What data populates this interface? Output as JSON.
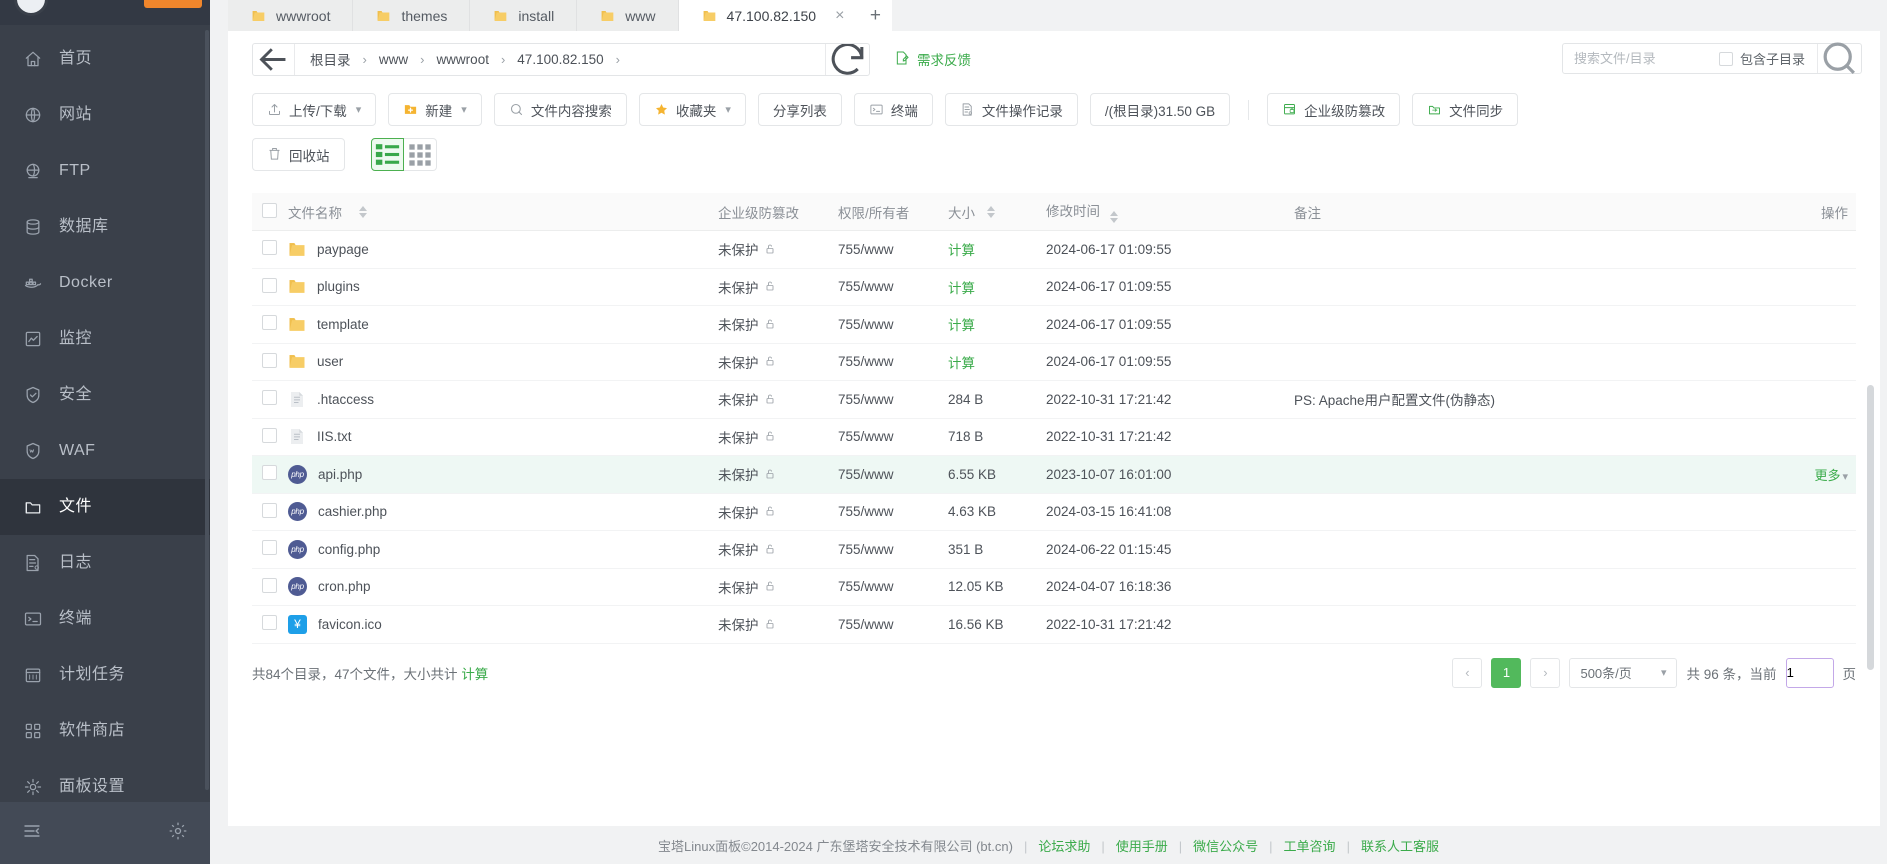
{
  "sidebar": {
    "items": [
      {
        "label": "首页",
        "icon": "home-icon",
        "active": false
      },
      {
        "label": "网站",
        "icon": "globe-icon",
        "active": false
      },
      {
        "label": "FTP",
        "icon": "ftp-icon",
        "active": false
      },
      {
        "label": "数据库",
        "icon": "database-icon",
        "active": false
      },
      {
        "label": "Docker",
        "icon": "docker-icon",
        "active": false
      },
      {
        "label": "监控",
        "icon": "monitor-icon",
        "active": false
      },
      {
        "label": "安全",
        "icon": "shield-icon",
        "active": false
      },
      {
        "label": "WAF",
        "icon": "waf-shield-icon",
        "active": false
      },
      {
        "label": "文件",
        "icon": "folder-icon",
        "active": true
      },
      {
        "label": "日志",
        "icon": "log-icon",
        "active": false
      },
      {
        "label": "终端",
        "icon": "terminal-icon",
        "active": false
      },
      {
        "label": "计划任务",
        "icon": "calendar-icon",
        "active": false
      },
      {
        "label": "软件商店",
        "icon": "appstore-icon",
        "active": false
      },
      {
        "label": "面板设置",
        "icon": "gear-icon",
        "active": false
      }
    ]
  },
  "tabs": [
    {
      "label": "wwwroot",
      "active": false,
      "closable": false
    },
    {
      "label": "themes",
      "active": false,
      "closable": false
    },
    {
      "label": "install",
      "active": false,
      "closable": false
    },
    {
      "label": "www",
      "active": false,
      "closable": false
    },
    {
      "label": "47.100.82.150",
      "active": true,
      "closable": true
    }
  ],
  "tab_add_label": "+",
  "path": {
    "crumbs": [
      "根目录",
      "www",
      "wwwroot",
      "47.100.82.150"
    ],
    "separator": "›",
    "trailing_separator": "›",
    "feedback_label": "需求反馈"
  },
  "search": {
    "placeholder": "搜索文件/目录",
    "value": "",
    "subdir_label": "包含子目录",
    "subdir_checked": false
  },
  "toolbar": {
    "row1": [
      {
        "label": "上传/下载",
        "icon": "upload-icon",
        "caret": true,
        "accent": ""
      },
      {
        "label": "新建",
        "icon": "new-folder-icon",
        "caret": true,
        "accent": "#f5b431"
      },
      {
        "label": "文件内容搜索",
        "icon": "search-icon",
        "caret": false,
        "accent": ""
      },
      {
        "label": "收藏夹",
        "icon": "star-icon",
        "caret": true,
        "accent": "#f5b431"
      },
      {
        "label": "分享列表",
        "icon": "",
        "caret": false,
        "accent": ""
      },
      {
        "label": "终端",
        "icon": "terminal-icon",
        "caret": false,
        "accent": ""
      },
      {
        "label": "文件操作记录",
        "icon": "log-icon",
        "caret": false,
        "accent": ""
      },
      {
        "label": "/(根目录)31.50 GB",
        "icon": "",
        "caret": false,
        "accent": ""
      },
      {
        "label": "企业级防篡改",
        "icon": "lock-box-icon",
        "caret": false,
        "accent": "#3bab4b"
      },
      {
        "label": "文件同步",
        "icon": "sync-folder-icon",
        "caret": false,
        "accent": "#3bab4b"
      }
    ],
    "recycle_label": "回收站",
    "view_list": "list-view-icon",
    "view_grid": "grid-view-icon"
  },
  "table": {
    "headers": {
      "name": "文件名称",
      "protection": "企业级防篡改",
      "permission": "权限/所有者",
      "size": "大小",
      "mtime": "修改时间",
      "note": "备注",
      "action": "操作"
    },
    "rows": [
      {
        "name": "paypage",
        "type": "folder",
        "protection": "未保护",
        "permission": "755/www",
        "size": "计算",
        "size_is_calc": true,
        "mtime": "2024-06-17 01:09:55",
        "note": "",
        "action": "",
        "hovered": false
      },
      {
        "name": "plugins",
        "type": "folder",
        "protection": "未保护",
        "permission": "755/www",
        "size": "计算",
        "size_is_calc": true,
        "mtime": "2024-06-17 01:09:55",
        "note": "",
        "action": "",
        "hovered": false
      },
      {
        "name": "template",
        "type": "folder",
        "protection": "未保护",
        "permission": "755/www",
        "size": "计算",
        "size_is_calc": true,
        "mtime": "2024-06-17 01:09:55",
        "note": "",
        "action": "",
        "hovered": false
      },
      {
        "name": "user",
        "type": "folder",
        "protection": "未保护",
        "permission": "755/www",
        "size": "计算",
        "size_is_calc": true,
        "mtime": "2024-06-17 01:09:55",
        "note": "",
        "action": "",
        "hovered": false
      },
      {
        "name": ".htaccess",
        "type": "text",
        "protection": "未保护",
        "permission": "755/www",
        "size": "284 B",
        "size_is_calc": false,
        "mtime": "2022-10-31 17:21:42",
        "note": "PS: Apache用户配置文件(伪静态)",
        "action": "",
        "hovered": false
      },
      {
        "name": "IIS.txt",
        "type": "text",
        "protection": "未保护",
        "permission": "755/www",
        "size": "718 B",
        "size_is_calc": false,
        "mtime": "2022-10-31 17:21:42",
        "note": "",
        "action": "",
        "hovered": false
      },
      {
        "name": "api.php",
        "type": "php",
        "protection": "未保护",
        "permission": "755/www",
        "size": "6.55 KB",
        "size_is_calc": false,
        "mtime": "2023-10-07 16:01:00",
        "note": "",
        "action": "更多",
        "hovered": true
      },
      {
        "name": "cashier.php",
        "type": "php",
        "protection": "未保护",
        "permission": "755/www",
        "size": "4.63 KB",
        "size_is_calc": false,
        "mtime": "2024-03-15 16:41:08",
        "note": "",
        "action": "",
        "hovered": false
      },
      {
        "name": "config.php",
        "type": "php",
        "protection": "未保护",
        "permission": "755/www",
        "size": "351 B",
        "size_is_calc": false,
        "mtime": "2024-06-22 01:15:45",
        "note": "",
        "action": "",
        "hovered": false
      },
      {
        "name": "cron.php",
        "type": "php",
        "protection": "未保护",
        "permission": "755/www",
        "size": "12.05 KB",
        "size_is_calc": false,
        "mtime": "2024-04-07 16:18:36",
        "note": "",
        "action": "",
        "hovered": false
      },
      {
        "name": "favicon.ico",
        "type": "ico",
        "protection": "未保护",
        "permission": "755/www",
        "size": "16.56 KB",
        "size_is_calc": false,
        "mtime": "2022-10-31 17:21:42",
        "note": "",
        "action": "",
        "hovered": false
      }
    ]
  },
  "footer_bar": {
    "summary": "共84个目录，47个文件，大小共计",
    "summary_link": "计算",
    "pager": {
      "prev": "‹",
      "pages": [
        "1"
      ],
      "current": "1",
      "next": "›",
      "page_size": "500条/页",
      "total_text": "共 96 条，当前",
      "jump_value": "1",
      "jump_suffix": "页"
    }
  },
  "page_footer": {
    "copyright": "宝塔Linux面板©2014-2024 广东堡塔安全技术有限公司 (bt.cn)",
    "links": [
      "论坛求助",
      "使用手册",
      "微信公众号",
      "工单咨询",
      "联系人工客服"
    ],
    "separator": "|"
  },
  "colors": {
    "accent_green": "#3bab4b",
    "sidebar_bg": "#3a404a",
    "sidebar_active": "#2f343d",
    "folder_yellow": "#f7cd66",
    "hover_row": "#eef8f4",
    "orange_badge": "#f0862c"
  }
}
